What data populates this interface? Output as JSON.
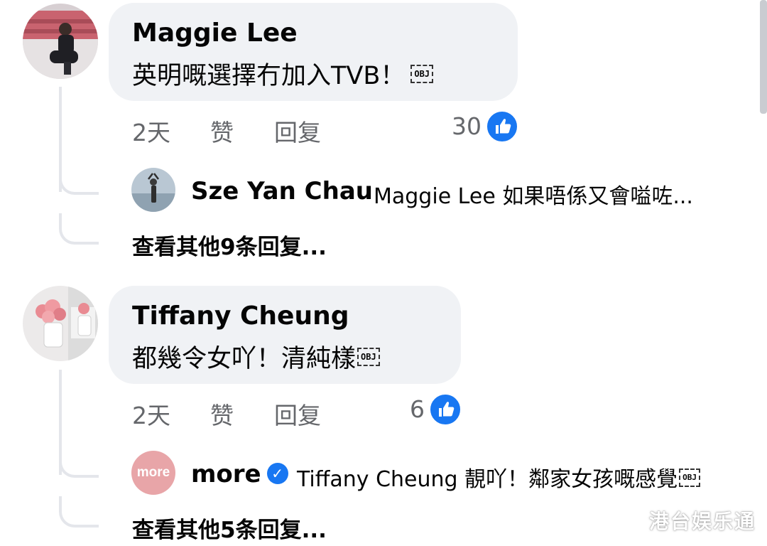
{
  "comments": [
    {
      "author": "Maggie Lee",
      "text": "英明嘅選擇冇加入TVB！",
      "obj_label": "OBJ",
      "time": "2天",
      "like_label": "赞",
      "reply_label": "回复",
      "like_count": "30",
      "reply_preview": {
        "author": "Sze Yan Chau",
        "text": "Maggie Lee 如果唔係又會嗌咗..."
      },
      "more_replies": "查看其他9条回复..."
    },
    {
      "author": "Tiffany Cheung",
      "text": "都幾令女吖！清純樣",
      "obj_label": "OBJ",
      "time": "2天",
      "like_label": "赞",
      "reply_label": "回复",
      "like_count": "6",
      "reply_preview": {
        "author": "more",
        "avatar_text": "more",
        "text": "Tiffany Cheung 靚吖！鄰家女孩嘅感覺",
        "obj_label": "OBJ"
      },
      "more_replies": "查看其他5条回复..."
    }
  ],
  "watermark": "港台娱乐通",
  "colors": {
    "bubble": "#f0f2f5",
    "like_blue": "#1877f2",
    "secondary_text": "#65676b",
    "more_avatar": "#e8a5a8"
  },
  "icons": {
    "like": "thumbs-up-icon",
    "verified": "verified-badge-icon"
  }
}
